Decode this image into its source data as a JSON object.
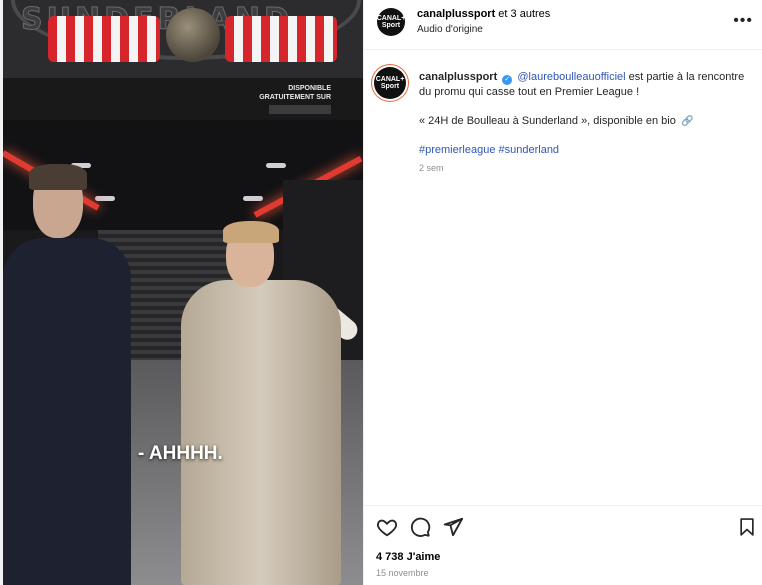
{
  "video": {
    "sign_text": "SUNDERLAND",
    "promo_line1": "DISPONIBLE",
    "promo_line2": "GRATUITEMENT SUR",
    "subtitle": "- AHHHH."
  },
  "header": {
    "avatar_text": "CANAL+ Sport",
    "username": "canalplussport",
    "others": " et 3 autres",
    "audio": "Audio d'origine",
    "more_icon": "more-horizontal-icon"
  },
  "caption": {
    "avatar_text": "CANAL+ Sport",
    "username": "canalplussport",
    "mention": "@laureboulleauofficiel",
    "text1": " est partie à la rencontre du promu qui casse tout en Premier League !",
    "text2": "« 24H de Boulleau à Sunderland », disponible en bio",
    "hashtag1": "#premierleague",
    "hashtag2": "#sunderland",
    "time_ago": "2 sem"
  },
  "actions": {
    "like_icon": "heart-icon",
    "comment_icon": "comment-icon",
    "share_icon": "send-icon",
    "save_icon": "bookmark-icon"
  },
  "stats": {
    "likes": "4 738 J'aime",
    "date": "15 novembre"
  }
}
